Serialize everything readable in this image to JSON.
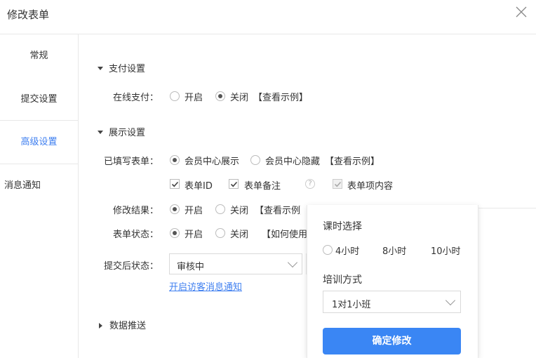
{
  "dialog": {
    "title": "修改表单"
  },
  "sidebar": {
    "items": [
      "常规",
      "提交设置",
      "高级设置",
      "消息通知"
    ]
  },
  "payment": {
    "heading": "支付设置",
    "label": "在线支付：",
    "options": [
      "开启",
      "关闭"
    ],
    "selected": "关闭",
    "example_link": "【查看示例】"
  },
  "display": {
    "heading": "展示设置",
    "filled_label": "已填写表单：",
    "filled_options": [
      "会员中心展示",
      "会员中心隐藏"
    ],
    "filled_selected": "会员中心展示",
    "filled_example": "【查看示例】",
    "checkboxes": [
      "表单ID",
      "表单备注",
      "表单项内容"
    ],
    "modify_label": "修改结果：",
    "modify_options": [
      "开启",
      "关闭"
    ],
    "modify_selected": "开启",
    "modify_example": "【查看示例】",
    "status_label": "表单状态：",
    "status_options": [
      "开启",
      "关闭"
    ],
    "status_selected": "开启",
    "status_link": "【如何使用表",
    "after_label": "提交后状态：",
    "after_value": "审核中",
    "visitor_link": "开启访客消息通知"
  },
  "data_push": {
    "heading": "数据推送"
  },
  "popup": {
    "hours_label": "课时选择",
    "hours_options": [
      "4小时",
      "8小时",
      "10小时"
    ],
    "training_label": "培训方式",
    "training_value": "1对1小班",
    "confirm": "确定修改"
  }
}
